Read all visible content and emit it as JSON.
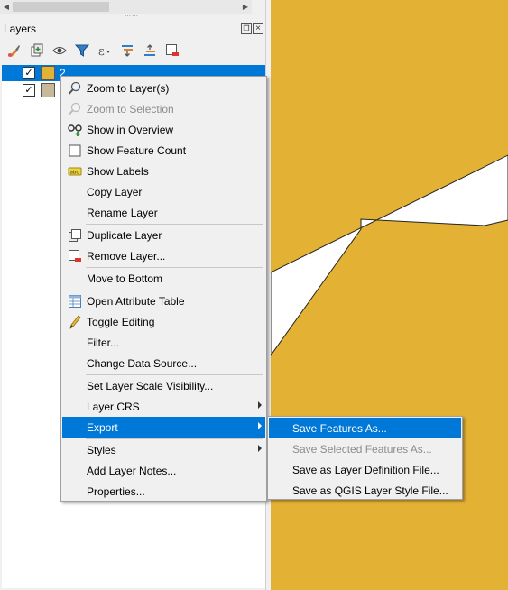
{
  "panel": {
    "title": "Layers",
    "float_glyph": "❐",
    "close_glyph": "×"
  },
  "toolbar": {
    "icons": [
      "style-brush-icon",
      "add-group-icon",
      "eye-visibility-icon",
      "filter-legend-icon",
      "filter-expression-icon",
      "expand-all-icon",
      "collapse-all-icon",
      "remove-layer-icon"
    ]
  },
  "layers": [
    {
      "name": "2",
      "checked": true,
      "check_glyph": "✓",
      "swatch_color": "#e3b133",
      "selected": true
    },
    {
      "name": "",
      "checked": true,
      "check_glyph": "✓",
      "swatch_color": "#c8b89a",
      "selected": false
    }
  ],
  "context_menu": {
    "items": [
      {
        "label": "Zoom to Layer(s)",
        "icon": "zoom-layer-icon",
        "disabled": false
      },
      {
        "label": "Zoom to Selection",
        "icon": "zoom-selection-icon",
        "disabled": true
      },
      {
        "label": "Show in Overview",
        "icon": "overview-icon",
        "disabled": false
      },
      {
        "label": "Show Feature Count",
        "icon": "checkbox-icon",
        "disabled": false
      },
      {
        "label": "Show Labels",
        "icon": "labels-icon",
        "disabled": false
      },
      {
        "label": "Copy Layer",
        "icon": "",
        "disabled": false
      },
      {
        "label": "Rename Layer",
        "icon": "",
        "disabled": false
      },
      {
        "label": "Duplicate Layer",
        "icon": "duplicate-layer-icon",
        "disabled": false
      },
      {
        "label": "Remove Layer...",
        "icon": "remove-layer-icon",
        "disabled": false
      },
      {
        "label": "Move to Bottom",
        "icon": "",
        "disabled": false
      },
      {
        "label": "Open Attribute Table",
        "icon": "attribute-table-icon",
        "disabled": false
      },
      {
        "label": "Toggle Editing",
        "icon": "pencil-icon",
        "disabled": false
      },
      {
        "label": "Filter...",
        "icon": "",
        "disabled": false
      },
      {
        "label": "Change Data Source...",
        "icon": "",
        "disabled": false
      },
      {
        "label": "Set Layer Scale Visibility...",
        "icon": "",
        "disabled": false
      },
      {
        "label": "Layer CRS",
        "icon": "",
        "disabled": false,
        "submenu": true
      },
      {
        "label": "Export",
        "icon": "",
        "disabled": false,
        "submenu": true,
        "highlighted": true
      },
      {
        "label": "Styles",
        "icon": "",
        "disabled": false,
        "submenu": true
      },
      {
        "label": "Add Layer Notes...",
        "icon": "",
        "disabled": false
      },
      {
        "label": "Properties...",
        "icon": "",
        "disabled": false
      }
    ]
  },
  "export_submenu": {
    "items": [
      {
        "label": "Save Features As...",
        "disabled": false,
        "highlighted": true
      },
      {
        "label": "Save Selected Features As...",
        "disabled": true
      },
      {
        "label": "Save as Layer Definition File...",
        "disabled": false
      },
      {
        "label": "Save as QGIS Layer Style File...",
        "disabled": false
      }
    ]
  },
  "colors": {
    "map_fill": "#e3b133",
    "highlight": "#0078d7",
    "menu_bg": "#f0f0f0"
  }
}
